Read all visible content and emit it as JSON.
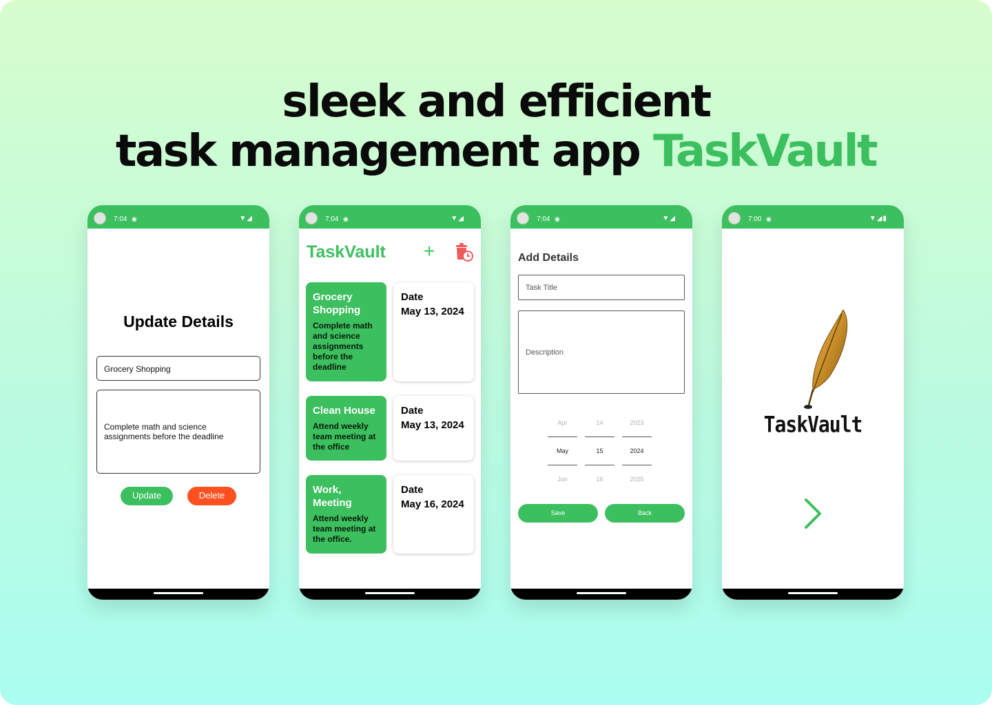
{
  "headline": {
    "line1": "sleek and efficient",
    "line2_prefix": "task management app ",
    "line2_brand": "TaskVault"
  },
  "colors": {
    "brand_green": "#3cbf5e",
    "delete_orange": "#fd5020",
    "trash_red": "#f05a5a"
  },
  "phones": [
    {
      "status": {
        "time": "7:04",
        "notif_icon": "android-icon",
        "icons": "wifi-icon signal-icon"
      }
    },
    {
      "status": {
        "time": "7:04",
        "notif_icon": "android-icon",
        "icons": "wifi-icon signal-icon"
      }
    },
    {
      "status": {
        "time": "7:04",
        "notif_icon": "android-icon",
        "icons": "wifi-icon signal-icon"
      }
    },
    {
      "status": {
        "time": "7:00",
        "notif_icon": "android-icon",
        "icons": "wifi-icon signal-icon battery-icon"
      }
    }
  ],
  "update_screen": {
    "title": "Update Details",
    "title_value": "Grocery Shopping",
    "description_value": "Complete math and science assignments before the deadline",
    "update_label": "Update",
    "delete_label": "Delete"
  },
  "list_screen": {
    "app_title": "TaskVault",
    "add_icon": "plus-icon",
    "clear_icon": "trash-clock-icon",
    "tasks": [
      {
        "title": "Grocery Shopping",
        "description": "Complete math and science assignments before the deadline",
        "date_label": "Date",
        "date": "May 13, 2024"
      },
      {
        "title": "Clean House",
        "description": "Attend weekly team meeting at the office",
        "date_label": "Date",
        "date": "May 13, 2024"
      },
      {
        "title": "Work, Meeting",
        "description": "Attend weekly team meeting at the office.",
        "date_label": "Date",
        "date": "May 16, 2024"
      }
    ]
  },
  "add_screen": {
    "title": "Add Details",
    "title_placeholder": "Task Title",
    "description_placeholder": "Description",
    "date_picker": {
      "month": {
        "prev": "Apr",
        "selected": "May",
        "next": "Jun"
      },
      "day": {
        "prev": "14",
        "selected": "15",
        "next": "16"
      },
      "year": {
        "prev": "2023",
        "selected": "2024",
        "next": "2025"
      }
    },
    "save_label": "Save",
    "back_label": "Back"
  },
  "splash_screen": {
    "logo_icon": "quill-feather-icon",
    "brand_name": "TaskVault",
    "next_icon": "chevron-right-icon"
  }
}
